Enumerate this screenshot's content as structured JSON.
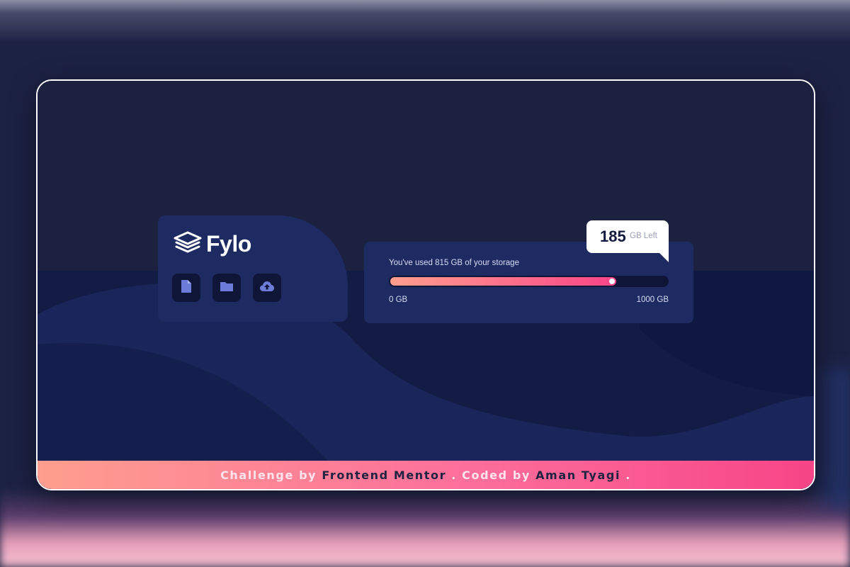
{
  "brand": {
    "name": "Fylo",
    "logo_icon": "stacked-layers-icon"
  },
  "toolbar": {
    "buttons": [
      {
        "icon": "document-icon"
      },
      {
        "icon": "folder-icon"
      },
      {
        "icon": "cloud-upload-icon"
      }
    ]
  },
  "storage": {
    "usage_text": "You've used 815 GB of your storage",
    "used_gb": 815,
    "total_gb": 1000,
    "used_fraction": 0.815,
    "min_label": "0 GB",
    "max_label": "1000 GB",
    "remaining_value": "185",
    "remaining_unit": "GB Left"
  },
  "footer": {
    "prefix": "Challenge by ",
    "challenge_link": "Frontend Mentor",
    "middle": " . Coded by ",
    "author_link": "Aman Tyagi",
    "suffix": " ."
  },
  "colors": {
    "background": "#1c2244",
    "card": "#1e2b63",
    "icon_bg": "#0e1536",
    "gradient_start": "#fe9e8e",
    "gradient_end": "#f74587",
    "accent_icon": "#6d7bd9"
  }
}
